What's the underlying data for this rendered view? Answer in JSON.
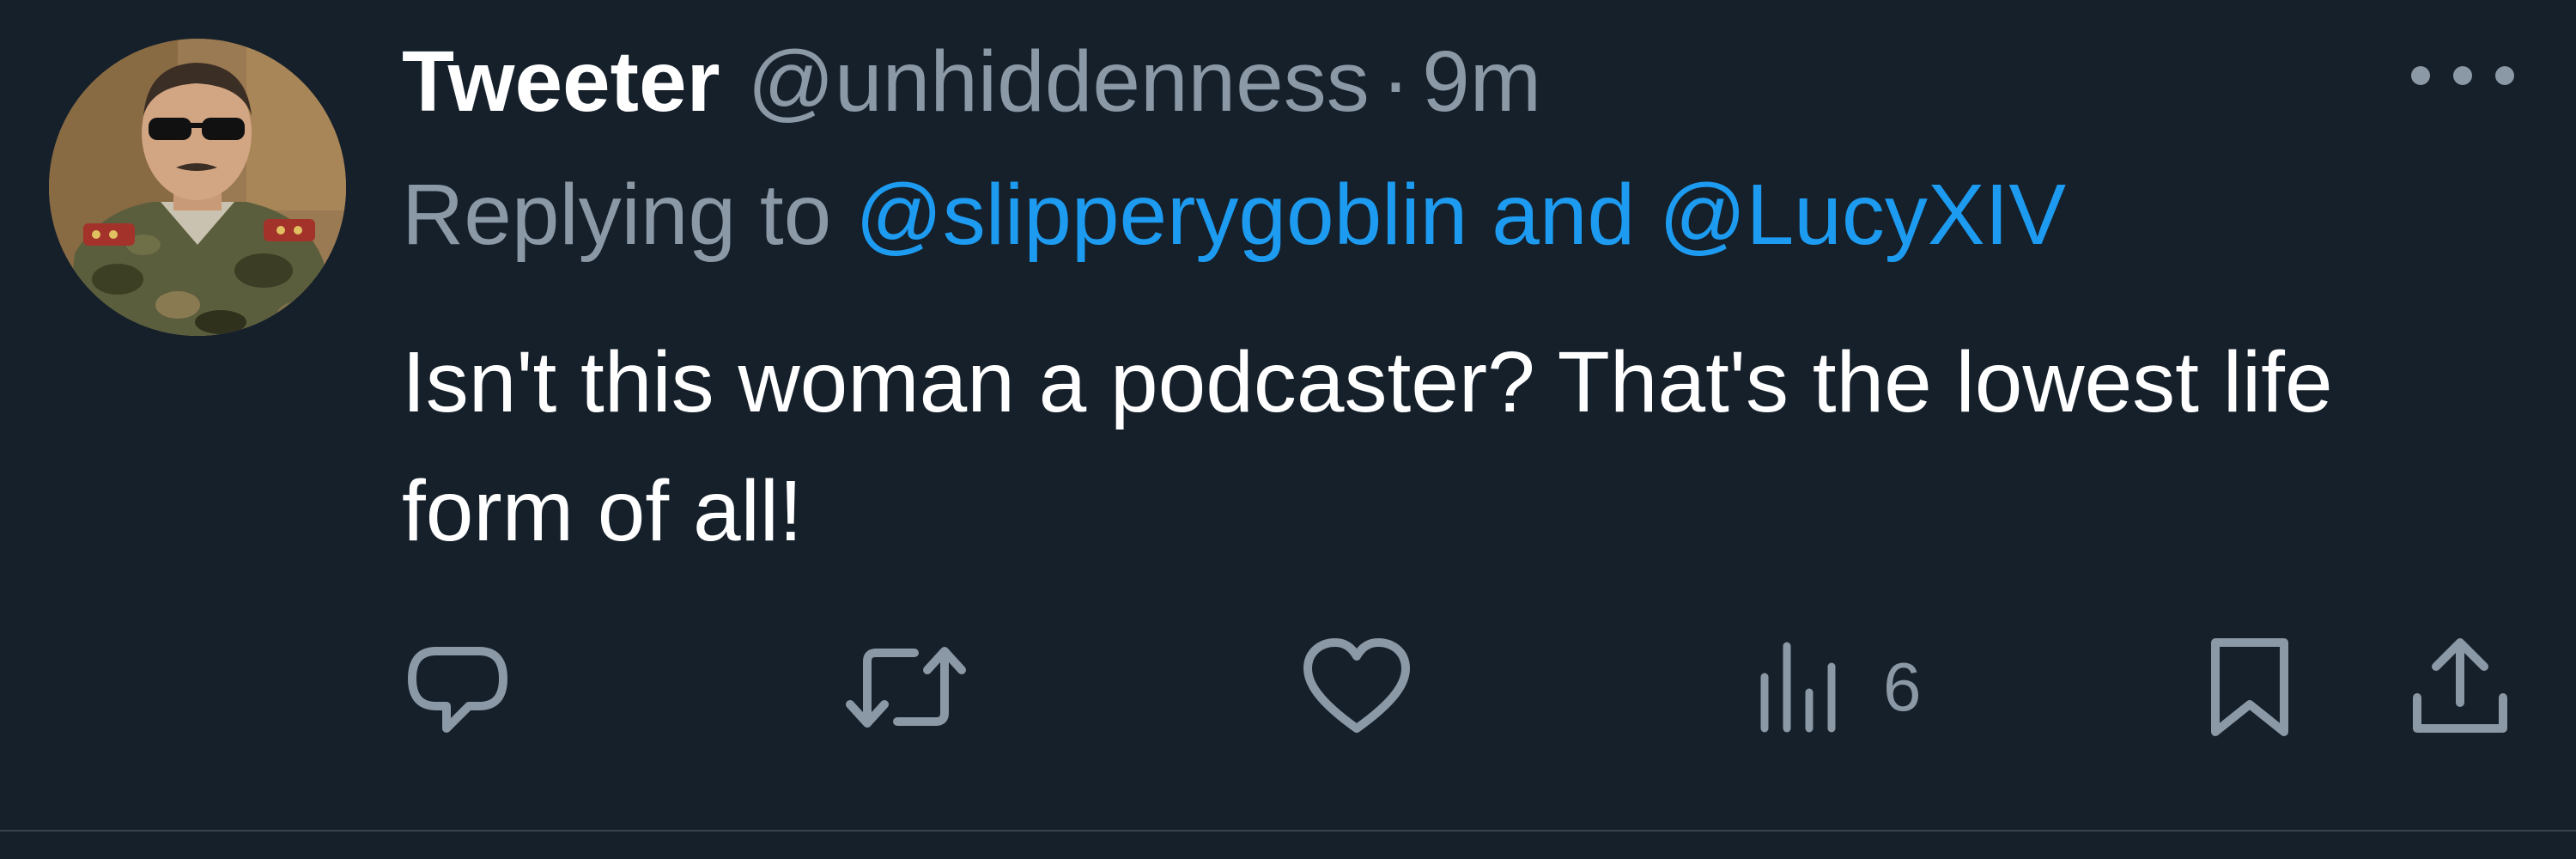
{
  "tweet": {
    "author": {
      "display_name": "Tweeter",
      "handle": "@unhiddenness",
      "avatar": "profile-photo-man-in-camouflage-uniform-with-sunglasses"
    },
    "separator": "·",
    "timestamp": "9m",
    "reply": {
      "prefix": "Replying to",
      "mention_1": "@slipperygoblin",
      "conjunction": "and",
      "mention_2": "@LucyXIV"
    },
    "text": "Isn't this woman a podcaster? That's the lowest life form of all!",
    "actions": {
      "reply": {
        "icon": "reply-bubble-icon"
      },
      "retweet": {
        "icon": "retweet-icon"
      },
      "like": {
        "icon": "heart-icon"
      },
      "views": {
        "icon": "bar-chart-icon",
        "count": "6"
      },
      "bookmark": {
        "icon": "bookmark-icon"
      },
      "share": {
        "icon": "share-upload-icon"
      }
    }
  },
  "colors": {
    "background": "#15202b",
    "primary_text": "#ffffff",
    "secondary_text": "#8b98a5",
    "link": "#1d9bf0",
    "divider": "#38444d"
  }
}
